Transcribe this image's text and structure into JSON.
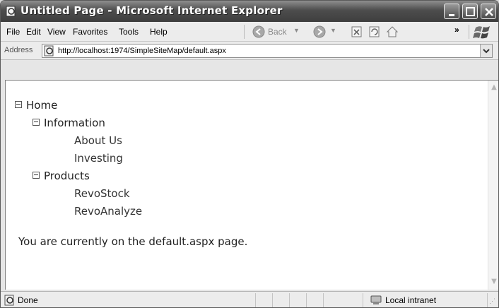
{
  "window": {
    "title": "Untitled Page - Microsoft Internet Explorer"
  },
  "menu": {
    "items": [
      "File",
      "Edit",
      "View",
      "Favorites",
      "Tools",
      "Help"
    ],
    "back_label": "Back",
    "overflow": "»"
  },
  "address": {
    "label": "Address",
    "url": "http://localhost:1974/SimpleSiteMap/default.aspx"
  },
  "tree": {
    "root": "Home",
    "sections": [
      {
        "label": "Information",
        "children": [
          "About Us",
          "Investing"
        ]
      },
      {
        "label": "Products",
        "children": [
          "RevoStock",
          "RevoAnalyze"
        ]
      }
    ]
  },
  "content": {
    "message": "You are currently on the default.aspx page."
  },
  "status": {
    "text": "Done",
    "zone": "Local intranet"
  },
  "icons": {
    "page_icon": "ie-page-icon",
    "back": "back-arrow-icon",
    "forward": "forward-arrow-icon",
    "stop": "stop-icon",
    "refresh": "refresh-icon",
    "home": "home-icon",
    "windows_logo": "windows-logo-icon",
    "zone": "local-intranet-icon"
  }
}
